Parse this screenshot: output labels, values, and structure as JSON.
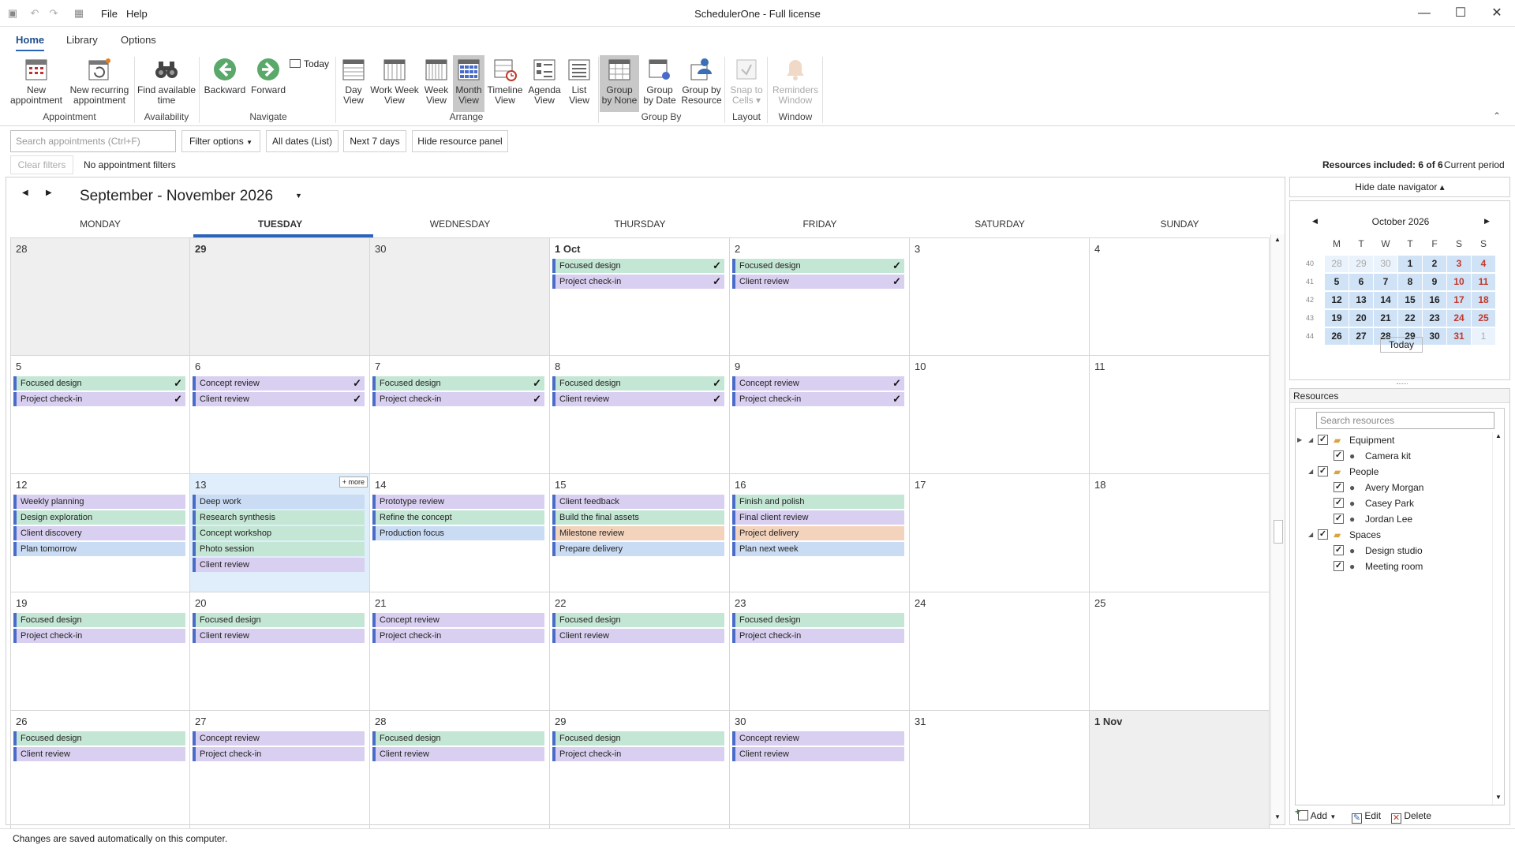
{
  "window": {
    "title": "SchedulerOne - Full license",
    "menu": [
      "File",
      "Help"
    ]
  },
  "ribbon_tabs": [
    "Home",
    "Library",
    "Options"
  ],
  "ribbon": {
    "buttons": [
      {
        "id": "new-appointment",
        "label1": "New",
        "label2": "appointment"
      },
      {
        "id": "new-recurring",
        "label1": "New recurring",
        "label2": "appointment"
      },
      {
        "id": "find-time",
        "label1": "Find available",
        "label2": "time"
      },
      {
        "id": "backward",
        "label1": "Backward",
        "label2": ""
      },
      {
        "id": "forward",
        "label1": "Forward",
        "label2": ""
      },
      {
        "id": "today",
        "label1": "Today",
        "label2": ""
      },
      {
        "id": "day-view",
        "label1": "Day",
        "label2": "View"
      },
      {
        "id": "work-week-view",
        "label1": "Work Week",
        "label2": "View"
      },
      {
        "id": "week-view",
        "label1": "Week",
        "label2": "View"
      },
      {
        "id": "month-view",
        "label1": "Month",
        "label2": "View"
      },
      {
        "id": "timeline-view",
        "label1": "Timeline",
        "label2": "View"
      },
      {
        "id": "agenda-view",
        "label1": "Agenda",
        "label2": "View"
      },
      {
        "id": "list-view",
        "label1": "List",
        "label2": "View"
      },
      {
        "id": "group-none",
        "label1": "Group",
        "label2": "by None"
      },
      {
        "id": "group-date",
        "label1": "Group",
        "label2": "by Date"
      },
      {
        "id": "group-resource",
        "label1": "Group by",
        "label2": "Resource"
      },
      {
        "id": "snap-cells",
        "label1": "Snap to",
        "label2": "Cells ▾"
      },
      {
        "id": "reminders",
        "label1": "Reminders",
        "label2": "Window"
      }
    ],
    "groups": [
      "Appointment",
      "Availability",
      "Navigate",
      "Arrange",
      "Group By",
      "Layout",
      "Window"
    ]
  },
  "toolbar": {
    "search_placeholder": "Search appointments (Ctrl+F)",
    "filter_options": "Filter options",
    "all_dates": "All dates (List)",
    "next_7_days": "Next 7 days",
    "hide_resource_panel": "Hide resource panel",
    "clear_filters": "Clear filters",
    "no_filters": "No appointment filters",
    "resources_included": "Resources included: 6 of 6",
    "current_period": "Current period"
  },
  "calendar": {
    "title": "September - November 2026",
    "days_of_week": [
      "MONDAY",
      "TUESDAY",
      "WEDNESDAY",
      "THURSDAY",
      "FRIDAY",
      "SATURDAY",
      "SUNDAY"
    ],
    "more_label": "+ more",
    "weeks": [
      [
        {
          "d": "28",
          "gray": true,
          "appts": []
        },
        {
          "d": "29",
          "gray": true,
          "bold": true,
          "appts": []
        },
        {
          "d": "30",
          "gray": true,
          "appts": []
        },
        {
          "d": "1 Oct",
          "bold": true,
          "appts": [
            {
              "t": "Focused design",
              "c": "green",
              "done": true
            },
            {
              "t": "Project check-in",
              "c": "purple",
              "done": true
            }
          ]
        },
        {
          "d": "2",
          "appts": [
            {
              "t": "Focused design",
              "c": "green",
              "done": true
            },
            {
              "t": "Client review",
              "c": "purple",
              "done": true
            }
          ]
        },
        {
          "d": "3",
          "appts": []
        },
        {
          "d": "4",
          "appts": []
        }
      ],
      [
        {
          "d": "5",
          "appts": [
            {
              "t": "Focused design",
              "c": "green",
              "done": true
            },
            {
              "t": "Project check-in",
              "c": "purple",
              "done": true
            }
          ]
        },
        {
          "d": "6",
          "appts": [
            {
              "t": "Concept review",
              "c": "purple",
              "done": true
            },
            {
              "t": "Client review",
              "c": "purple",
              "done": true
            }
          ]
        },
        {
          "d": "7",
          "appts": [
            {
              "t": "Focused design",
              "c": "green",
              "done": true
            },
            {
              "t": "Project check-in",
              "c": "purple",
              "done": true
            }
          ]
        },
        {
          "d": "8",
          "appts": [
            {
              "t": "Focused design",
              "c": "green",
              "done": true
            },
            {
              "t": "Client review",
              "c": "purple",
              "done": true
            }
          ]
        },
        {
          "d": "9",
          "appts": [
            {
              "t": "Concept review",
              "c": "purple",
              "done": true
            },
            {
              "t": "Project check-in",
              "c": "purple",
              "done": true
            }
          ]
        },
        {
          "d": "10",
          "appts": []
        },
        {
          "d": "11",
          "appts": []
        }
      ],
      [
        {
          "d": "12",
          "appts": [
            {
              "t": "Weekly planning",
              "c": "purple"
            },
            {
              "t": "Design exploration",
              "c": "green"
            },
            {
              "t": "Client discovery",
              "c": "purple"
            },
            {
              "t": "Plan tomorrow",
              "c": "blue"
            }
          ]
        },
        {
          "d": "13",
          "sel": true,
          "more": true,
          "appts": [
            {
              "t": "Deep work",
              "c": "blue"
            },
            {
              "t": "Research synthesis",
              "c": "green"
            },
            {
              "t": "Concept workshop",
              "c": "green"
            },
            {
              "t": "Photo session",
              "c": "green"
            },
            {
              "t": "Client review",
              "c": "purple"
            }
          ]
        },
        {
          "d": "14",
          "appts": [
            {
              "t": "Prototype review",
              "c": "purple"
            },
            {
              "t": "Refine the concept",
              "c": "green"
            },
            {
              "t": "Production focus",
              "c": "blue"
            }
          ]
        },
        {
          "d": "15",
          "appts": [
            {
              "t": "Client feedback",
              "c": "purple"
            },
            {
              "t": "Build the final assets",
              "c": "green"
            },
            {
              "t": "Milestone review",
              "c": "orange"
            },
            {
              "t": "Prepare delivery",
              "c": "blue"
            }
          ]
        },
        {
          "d": "16",
          "appts": [
            {
              "t": "Finish and polish",
              "c": "green"
            },
            {
              "t": "Final client review",
              "c": "purple"
            },
            {
              "t": "Project delivery",
              "c": "orange"
            },
            {
              "t": "Plan next week",
              "c": "blue"
            }
          ]
        },
        {
          "d": "17",
          "appts": []
        },
        {
          "d": "18",
          "appts": []
        }
      ],
      [
        {
          "d": "19",
          "appts": [
            {
              "t": "Focused design",
              "c": "green"
            },
            {
              "t": "Project check-in",
              "c": "purple"
            }
          ]
        },
        {
          "d": "20",
          "appts": [
            {
              "t": "Focused design",
              "c": "green"
            },
            {
              "t": "Client review",
              "c": "purple"
            }
          ]
        },
        {
          "d": "21",
          "appts": [
            {
              "t": "Concept review",
              "c": "purple"
            },
            {
              "t": "Project check-in",
              "c": "purple"
            }
          ]
        },
        {
          "d": "22",
          "appts": [
            {
              "t": "Focused design",
              "c": "green"
            },
            {
              "t": "Client review",
              "c": "purple"
            }
          ]
        },
        {
          "d": "23",
          "appts": [
            {
              "t": "Focused design",
              "c": "green"
            },
            {
              "t": "Project check-in",
              "c": "purple"
            }
          ]
        },
        {
          "d": "24",
          "appts": []
        },
        {
          "d": "25",
          "appts": []
        }
      ],
      [
        {
          "d": "26",
          "appts": [
            {
              "t": "Focused design",
              "c": "green"
            },
            {
              "t": "Client review",
              "c": "purple"
            }
          ]
        },
        {
          "d": "27",
          "appts": [
            {
              "t": "Concept review",
              "c": "purple"
            },
            {
              "t": "Project check-in",
              "c": "purple"
            }
          ]
        },
        {
          "d": "28",
          "appts": [
            {
              "t": "Focused design",
              "c": "green"
            },
            {
              "t": "Client review",
              "c": "purple"
            }
          ]
        },
        {
          "d": "29",
          "appts": [
            {
              "t": "Focused design",
              "c": "green"
            },
            {
              "t": "Project check-in",
              "c": "purple"
            }
          ]
        },
        {
          "d": "30",
          "appts": [
            {
              "t": "Concept review",
              "c": "purple"
            },
            {
              "t": "Client review",
              "c": "purple"
            }
          ]
        },
        {
          "d": "31",
          "appts": []
        },
        {
          "d": "1 Nov",
          "gray": true,
          "bold": true,
          "appts": []
        }
      ]
    ]
  },
  "date_navigator": {
    "hide_label": "Hide date navigator ▴",
    "month_title": "October 2026",
    "headers": [
      "M",
      "T",
      "W",
      "T",
      "F",
      "S",
      "S"
    ],
    "week_numbers": [
      "40",
      "41",
      "42",
      "43",
      "44"
    ],
    "rows": [
      [
        "28",
        "29",
        "30",
        "1",
        "2",
        "3",
        "4"
      ],
      [
        "5",
        "6",
        "7",
        "8",
        "9",
        "10",
        "11"
      ],
      [
        "12",
        "13",
        "14",
        "15",
        "16",
        "17",
        "18"
      ],
      [
        "19",
        "20",
        "21",
        "22",
        "23",
        "24",
        "25"
      ],
      [
        "26",
        "27",
        "28",
        "29",
        "30",
        "31",
        "1"
      ]
    ],
    "today_label": "Today"
  },
  "resources": {
    "title": "Resources",
    "search_placeholder": "Search resources",
    "tree": [
      {
        "label": "Equipment",
        "level": 0,
        "folder": true
      },
      {
        "label": "Camera kit",
        "level": 1
      },
      {
        "label": "People",
        "level": 0,
        "folder": true
      },
      {
        "label": "Avery Morgan",
        "level": 1
      },
      {
        "label": "Casey Park",
        "level": 1
      },
      {
        "label": "Jordan Lee",
        "level": 1
      },
      {
        "label": "Spaces",
        "level": 0,
        "folder": true
      },
      {
        "label": "Design studio",
        "level": 1
      },
      {
        "label": "Meeting room",
        "level": 1
      }
    ],
    "add": "Add",
    "edit": "Edit",
    "delete": "Delete"
  },
  "status": "Changes are saved automatically on this computer.",
  "colors": {
    "accent": "#2b63b8",
    "green": "#c4e6d4",
    "purple": "#d9cff0",
    "blue": "#c9dcf4",
    "orange": "#f3d3bb",
    "weekend_red": "#c0392b"
  }
}
